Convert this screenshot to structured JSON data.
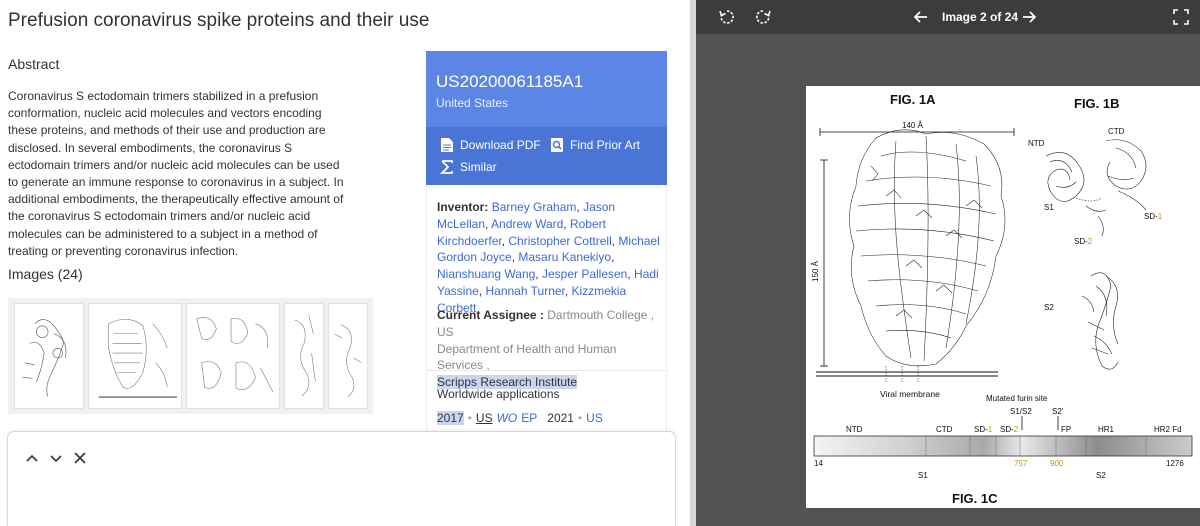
{
  "patent": {
    "title": "Prefusion coronavirus spike proteins and their use",
    "abstract_heading": "Abstract",
    "abstract_text": "Coronavirus S ectodomain trimers stabilized in a prefusion conformation, nucleic acid molecules and vectors encoding these proteins, and methods of their use and production are disclosed. In several embodiments, the coronavirus S ectodomain trimers and/or nucleic acid molecules can be used to generate an immune response to coronavirus in a subject. In additional embodiments, the therapeutically effective amount of the coronavirus S ectodomain trimers and/or nucleic acid molecules can be administered to a subject in a method of treating or preventing coronavirus infection.",
    "images_heading": "Images (24)"
  },
  "card": {
    "publication_number": "US20200061185A1",
    "country": "United States",
    "download_pdf": "Download PDF",
    "find_prior_art": "Find Prior Art",
    "similar": "Similar"
  },
  "meta": {
    "inventor_label": "Inventor:",
    "inventors": [
      "Barney Graham",
      "Jason McLellan",
      "Andrew Ward",
      "Robert Kirchdoerfer",
      "Christopher Cottrell",
      "Michael Gordon Joyce",
      "Masaru Kanekiyo",
      "Nianshuang Wang",
      "Jesper Pallesen",
      "Hadi Yassine",
      "Hannah Turner",
      "Kizzmekia Corbett"
    ],
    "assignee_label": "Current Assignee :",
    "assignees": [
      "Dartmouth College , US",
      "Department of Health and Human Services ,",
      "Scripps Research Institute"
    ],
    "worldwide_heading": "Worldwide applications",
    "ww_year1": "2017",
    "ww_sep": "•",
    "ww_us1": "US",
    "ww_wo": "WO",
    "ww_ep": "EP",
    "ww_year2": "2021",
    "ww_us2": "US"
  },
  "viewer": {
    "counter": "Image 2 of 24",
    "fig_1a": "FIG. 1A",
    "fig_1b": "FIG. 1B",
    "fig_1c": "FIG. 1C",
    "dim_140": "140 Å",
    "dim_150": "150 Å",
    "viral_membrane": "Viral membrane",
    "ntd_b": "NTD",
    "ctd_b": "CTD",
    "s1_b": "S1",
    "sd1_b_prefix": "SD-",
    "sd1_b_num": "1",
    "sd2_b_prefix": "SD-",
    "sd2_b_num": "2",
    "s2_b": "S2",
    "mutated_furin": "Mutated furin site",
    "s1s2": "S1/S2",
    "s2prime": "S2'",
    "bar_ntd": "NTD",
    "bar_ctd": "CTD",
    "bar_sd1_prefix": "SD-",
    "bar_sd1_num": "1",
    "bar_sd2_prefix": "SD-",
    "bar_sd2_num": "2",
    "bar_fp": "FP",
    "bar_hr1": "HR1",
    "bar_hr2": "HR2 Fd",
    "num_14": "14",
    "num_757": "757",
    "num_900": "900",
    "num_1276": "1276",
    "bar_s1": "S1",
    "bar_s2": "S2",
    "accent_color": "#c8940a"
  },
  "colors": {
    "card_blue": "#5b86e5",
    "card_blue_dark": "#4a74d6",
    "link_blue": "#3a6ad8",
    "viewer_bg": "#535353"
  }
}
